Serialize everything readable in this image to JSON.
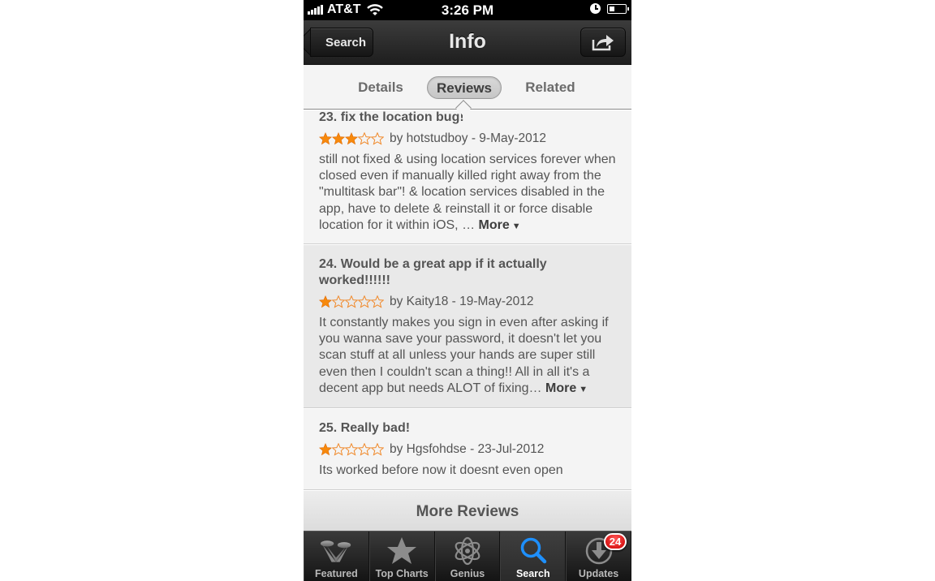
{
  "status_bar": {
    "carrier": "AT&T",
    "time": "3:26 PM",
    "battery_level": 0.35
  },
  "nav_bar": {
    "back_label": "Search",
    "title": "Info",
    "share_icon": "share-icon"
  },
  "segments": {
    "items": [
      {
        "label": "Details",
        "selected": false
      },
      {
        "label": "Reviews",
        "selected": true
      },
      {
        "label": "Related",
        "selected": false
      }
    ]
  },
  "reviews": [
    {
      "title": "23. fix the location bug!",
      "rating": 3,
      "max_rating": 5,
      "byline": "by hotstudboy - 9-May-2012",
      "body": "still not fixed & using location services forever when closed even if manually killed right away from the \"multitask bar\"! & location services disabled in the app, have to delete & reinstall it or force disable location for it within iOS, … ",
      "more_label": "More",
      "more_icon": "▼"
    },
    {
      "title": "24. Would be a great app if it actually worked!!!!!!",
      "rating": 1,
      "max_rating": 5,
      "byline": "by Kaity18 - 19-May-2012",
      "body": "It constantly makes you sign in even after asking if you wanna save your password, it doesn't let you scan stuff at all unless your hands are super still even then I couldn't scan a thing!! All in all it's a decent app but needs ALOT of fixing… ",
      "more_label": "More",
      "more_icon": "▼"
    },
    {
      "title": "25. Really bad!",
      "rating": 1,
      "max_rating": 5,
      "byline": "by Hgsfohdse - 23-Jul-2012",
      "body": "Its worked before now it doesnt even open"
    }
  ],
  "more_reviews_label": "More Reviews",
  "colors": {
    "star_filled": "#f7890c",
    "star_empty": "#f08a2c",
    "active_tab_icon": "#1e90ff",
    "badge": "#d40000"
  },
  "tab_bar": {
    "tabs": [
      {
        "label": "Featured",
        "icon": "featured-icon",
        "active": false
      },
      {
        "label": "Top Charts",
        "icon": "star-icon",
        "active": false
      },
      {
        "label": "Genius",
        "icon": "atom-icon",
        "active": false
      },
      {
        "label": "Search",
        "icon": "search-icon",
        "active": true
      },
      {
        "label": "Updates",
        "icon": "download-icon",
        "active": false,
        "badge": "24"
      }
    ]
  }
}
